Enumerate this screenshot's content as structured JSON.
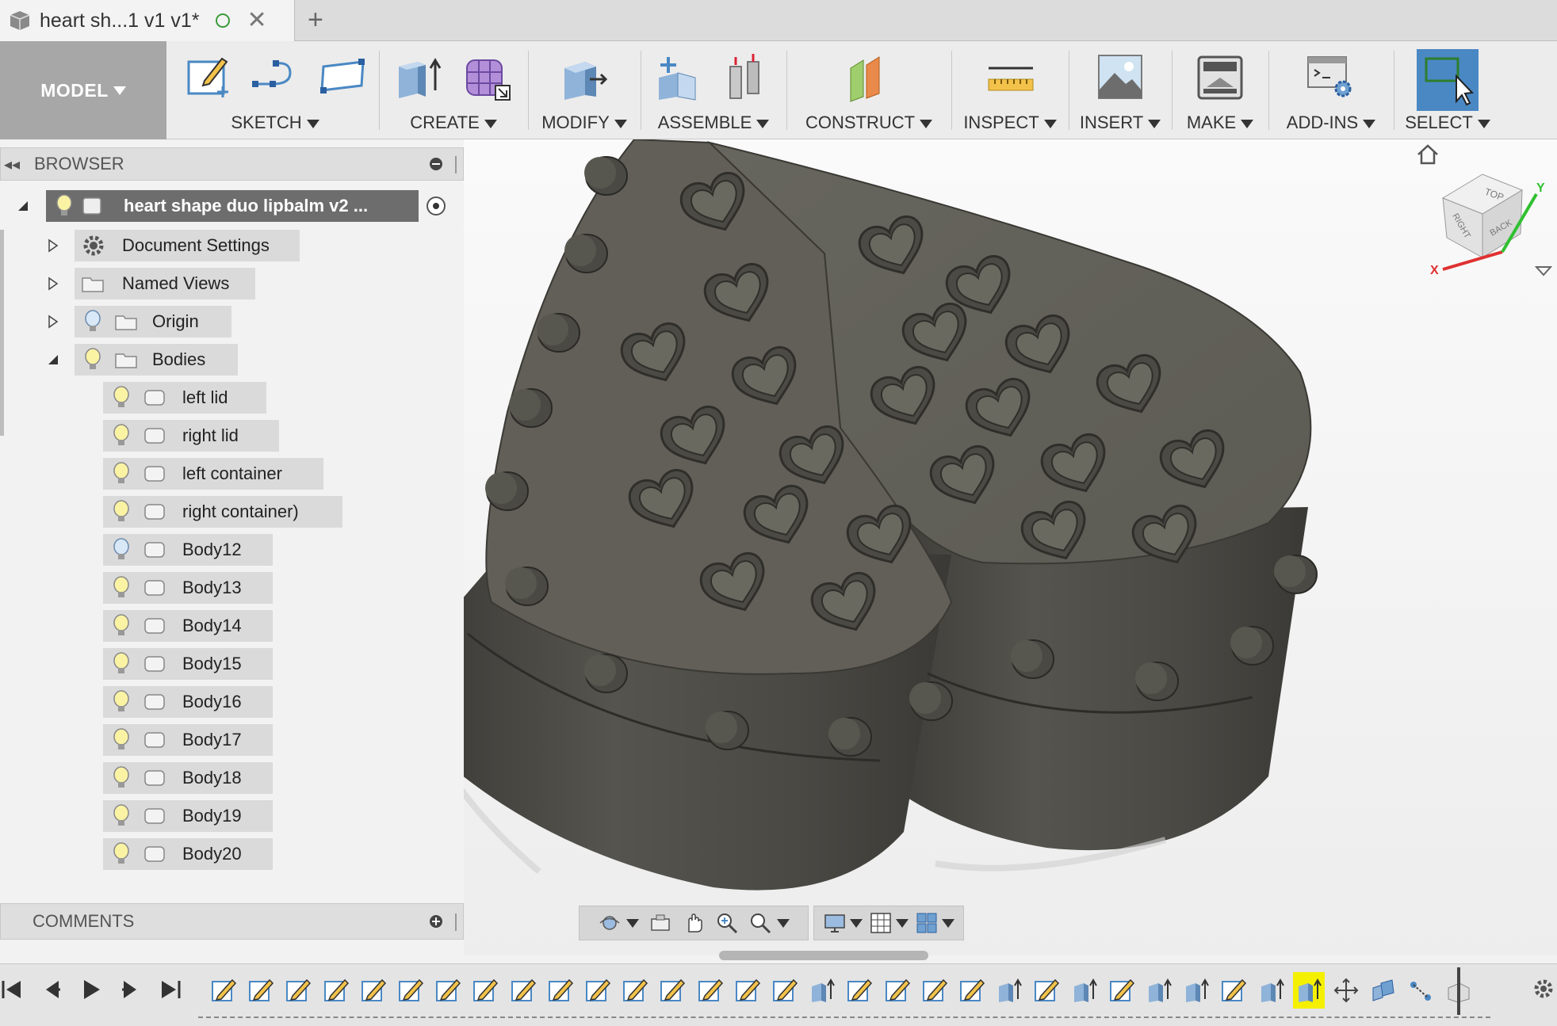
{
  "tab": {
    "title": "heart sh...1 v1 v1*",
    "close_glyph": "✕",
    "new_tab_glyph": "+",
    "status_icon": "online-status-icon"
  },
  "toolbar": {
    "workspace_label": "MODEL",
    "groups": [
      {
        "label": "SKETCH",
        "icons": [
          "create-sketch-icon",
          "line-icon",
          "rectangle-icon"
        ]
      },
      {
        "label": "CREATE",
        "icons": [
          "extrude-icon",
          "form-icon"
        ]
      },
      {
        "label": "MODIFY",
        "icons": [
          "press-pull-icon"
        ]
      },
      {
        "label": "ASSEMBLE",
        "icons": [
          "new-component-icon",
          "joint-icon"
        ]
      },
      {
        "label": "CONSTRUCT",
        "icons": [
          "offset-plane-icon"
        ]
      },
      {
        "label": "INSPECT",
        "icons": [
          "measure-icon"
        ]
      },
      {
        "label": "INSERT",
        "icons": [
          "insert-image-icon"
        ]
      },
      {
        "label": "MAKE",
        "icons": [
          "3d-print-icon"
        ]
      },
      {
        "label": "ADD-INS",
        "icons": [
          "scripts-icon"
        ]
      },
      {
        "label": "SELECT",
        "icons": [
          "select-icon"
        ]
      }
    ]
  },
  "browser": {
    "title": "BROWSER",
    "root_label": "heart shape duo lipbalm v2 ...",
    "items": [
      {
        "label": "Document Settings",
        "icon": "gear-icon",
        "expanded": false
      },
      {
        "label": "Named Views",
        "icon": "folder-icon",
        "expanded": false
      },
      {
        "label": "Origin",
        "icon": "folder-icon",
        "expanded": false
      },
      {
        "label": "Bodies",
        "icon": "folder-icon",
        "expanded": true
      }
    ],
    "bodies": [
      {
        "label": "left lid"
      },
      {
        "label": "right lid"
      },
      {
        "label": "left container"
      },
      {
        "label": "right container)"
      },
      {
        "label": "Body12"
      },
      {
        "label": "Body13"
      },
      {
        "label": "Body14"
      },
      {
        "label": "Body15"
      },
      {
        "label": "Body16"
      },
      {
        "label": "Body17"
      },
      {
        "label": "Body18"
      },
      {
        "label": "Body19"
      },
      {
        "label": "Body20"
      }
    ]
  },
  "comments": {
    "title": "COMMENTS"
  },
  "viewcube": {
    "faces": [
      "TOP",
      "RIGHT",
      "BACK"
    ],
    "axes": [
      "X",
      "Y"
    ]
  },
  "navbar": {
    "buttons": [
      "orbit-icon",
      "look-at-icon",
      "pan-icon",
      "zoom-window-icon",
      "zoom-icon",
      "display-settings-icon",
      "grid-icon",
      "viewports-icon"
    ]
  },
  "timeline": {
    "controls": [
      "skip-start-icon",
      "step-back-icon",
      "play-icon",
      "step-forward-icon",
      "skip-end-icon"
    ],
    "feature_icons": [
      "sketch",
      "sketch",
      "sketch",
      "sketch",
      "sketch",
      "sketch",
      "sketch",
      "sketch",
      "sketch",
      "sketch",
      "sketch",
      "sketch",
      "sketch",
      "sketch",
      "sketch",
      "sketch",
      "extrude",
      "sketch",
      "sketch",
      "sketch",
      "sketch",
      "extrude",
      "sketch",
      "extrude",
      "sketch",
      "extrude",
      "extrude",
      "sketch",
      "extrude",
      "extrude",
      "move",
      "combine",
      "joint",
      "component"
    ],
    "selected_index": 29
  },
  "colors": {
    "accent": "#4a88c4",
    "workspace_bg": "#a7a7a7",
    "model": "#5b5a54"
  }
}
